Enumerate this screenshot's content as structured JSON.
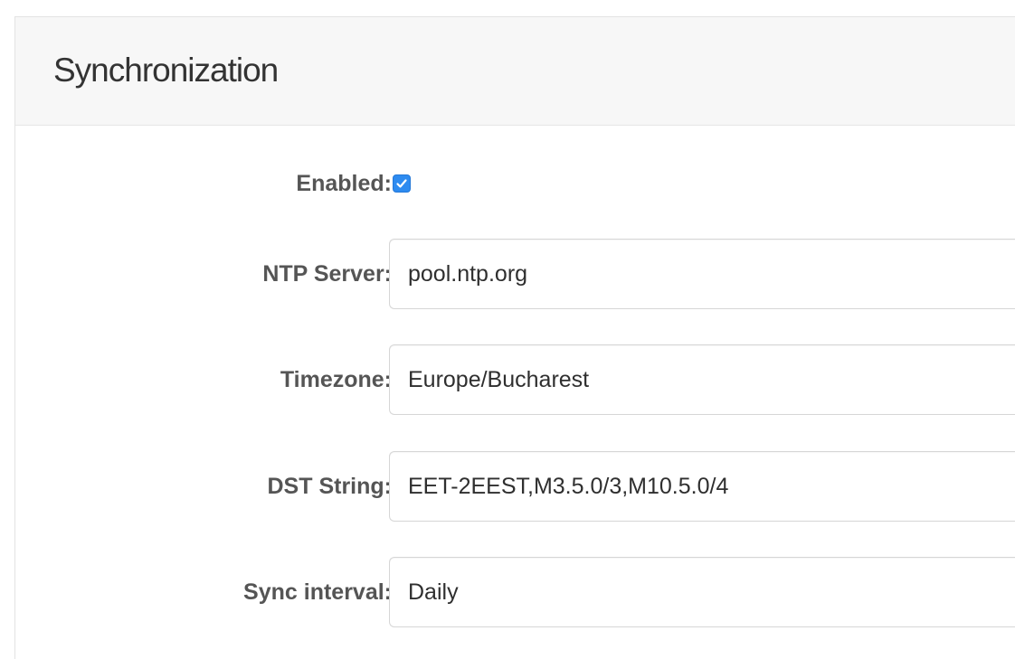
{
  "panel": {
    "title": "Synchronization"
  },
  "form": {
    "enabled": {
      "label": "Enabled:",
      "checked": true
    },
    "ntp_server": {
      "label": "NTP Server:",
      "value": "pool.ntp.org"
    },
    "timezone": {
      "label": "Timezone:",
      "value": "Europe/Bucharest"
    },
    "dst_string": {
      "label": "DST String:",
      "value": "EET-2EEST,M3.5.0/3,M10.5.0/4"
    },
    "sync_interval": {
      "label": "Sync interval:",
      "value": "Daily"
    }
  },
  "colors": {
    "checkbox_accent": "#2e8bf0",
    "label_text": "#555555",
    "header_background": "#f7f7f7"
  }
}
